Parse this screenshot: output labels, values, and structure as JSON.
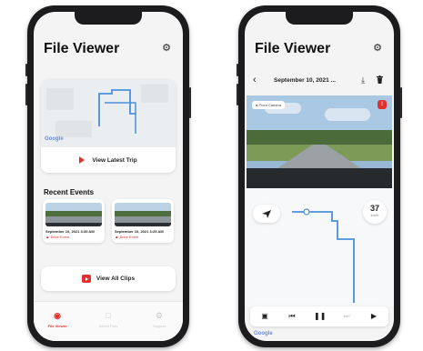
{
  "left_screen": {
    "title": "File Viewer",
    "settings_icon": "gear-icon",
    "map_attribution": "Google",
    "latest_trip_label": "View Latest Trip",
    "recent_events_title": "Recent Events",
    "events": [
      {
        "date": "September 10, 2021 3:35 AM",
        "type": "Drive Event"
      },
      {
        "date": "September 10, 2021 3:25 AM",
        "type": "Drive Event"
      }
    ],
    "view_all_clips_label": "View All Clips",
    "tabs": [
      {
        "label": "File Viewer",
        "icon": "dashcam-icon",
        "active": true
      },
      {
        "label": "Saved Files",
        "icon": "saved-files-icon",
        "active": false
      },
      {
        "label": "Support",
        "icon": "support-icon",
        "active": false
      }
    ]
  },
  "right_screen": {
    "title": "File Viewer",
    "settings_icon": "gear-icon",
    "back_icon": "chevron-left-icon",
    "date_label": "September 10, 2021 ...",
    "camera_label": "Front Camera",
    "speed_value": "37",
    "speed_unit": "km/h",
    "map_attribution": "Google",
    "controls": [
      "camera-switch-icon",
      "skip-back-icon",
      "pause-icon",
      "skip-forward-icon",
      "video-camera-icon"
    ]
  },
  "colors": {
    "accent": "#e0312e",
    "route": "#4a90d9"
  }
}
